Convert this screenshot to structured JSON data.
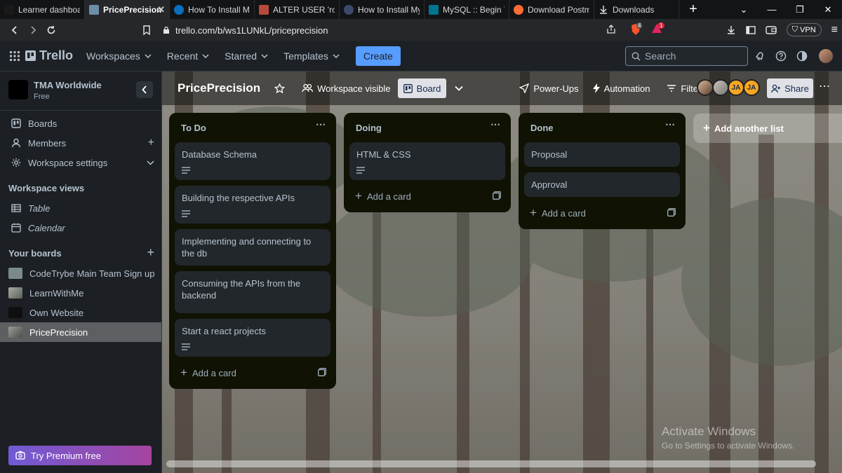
{
  "browser": {
    "tabs": [
      {
        "title": "Learner dashboard",
        "color": "#1a1a1a"
      },
      {
        "title": "PricePrecision",
        "color": "#6c8fa8"
      },
      {
        "title": "How To Install MyS",
        "color": "#0a6ebd"
      },
      {
        "title": "ALTER USER 'root'@",
        "color": "#b84a3c"
      },
      {
        "title": "How to Install MyS",
        "color": "#3b4a6b"
      },
      {
        "title": "MySQL :: Begin You",
        "color": "#00758f"
      },
      {
        "title": "Download Postma",
        "color": "#ff6c37"
      },
      {
        "title": "Downloads",
        "color": "#444"
      }
    ],
    "url": "trello.com/b/ws1LUNkL/priceprecision",
    "brave_badge": "4",
    "alert_badge": "1",
    "vpn_label": "VPN"
  },
  "header": {
    "logo": "Trello",
    "nav": [
      "Workspaces",
      "Recent",
      "Starred",
      "Templates"
    ],
    "create_label": "Create",
    "search_placeholder": "Search"
  },
  "sidebar": {
    "workspace_name": "TMA Worldwide",
    "workspace_plan": "Free",
    "items": [
      {
        "label": "Boards"
      },
      {
        "label": "Members"
      },
      {
        "label": "Workspace settings"
      }
    ],
    "views_heading": "Workspace views",
    "views": [
      {
        "label": "Table"
      },
      {
        "label": "Calendar"
      }
    ],
    "boards_heading": "Your boards",
    "boards": [
      {
        "label": "CodeTrybe Main Team Sign up",
        "color": "#7a8a8a"
      },
      {
        "label": "LearnWithMe",
        "color": "#8a8f8a"
      },
      {
        "label": "Own Website",
        "color": "#0f0f0f"
      },
      {
        "label": "PricePrecision",
        "color": "#6b6f6a"
      }
    ],
    "premium_label": "Try Premium free"
  },
  "board": {
    "title": "PricePrecision",
    "visibility_label": "Workspace visible",
    "view_label": "Board",
    "powerups_label": "Power-Ups",
    "automation_label": "Automation",
    "filter_label": "Filter",
    "members": [
      "",
      "",
      "JA",
      "JA"
    ],
    "share_label": "Share",
    "add_list_label": "Add another list",
    "lists": [
      {
        "title": "To Do",
        "cards": [
          {
            "title": "Database Schema",
            "has_description": true
          },
          {
            "title": "Building the respective APIs",
            "has_description": true
          },
          {
            "title": "Implementing and connecting to the db",
            "has_description": false
          },
          {
            "title": "Consuming the APIs from the backend",
            "has_description": false
          },
          {
            "title": "Start a react projects",
            "has_description": true
          }
        ],
        "add_card_label": "Add a card"
      },
      {
        "title": "Doing",
        "cards": [
          {
            "title": "HTML & CSS",
            "has_description": true
          }
        ],
        "add_card_label": "Add a card"
      },
      {
        "title": "Done",
        "cards": [
          {
            "title": "Proposal",
            "has_description": false
          },
          {
            "title": "Approval",
            "has_description": false
          }
        ],
        "add_card_label": "Add a card"
      }
    ]
  },
  "watermark": {
    "line1": "Activate Windows",
    "line2": "Go to Settings to activate Windows."
  }
}
